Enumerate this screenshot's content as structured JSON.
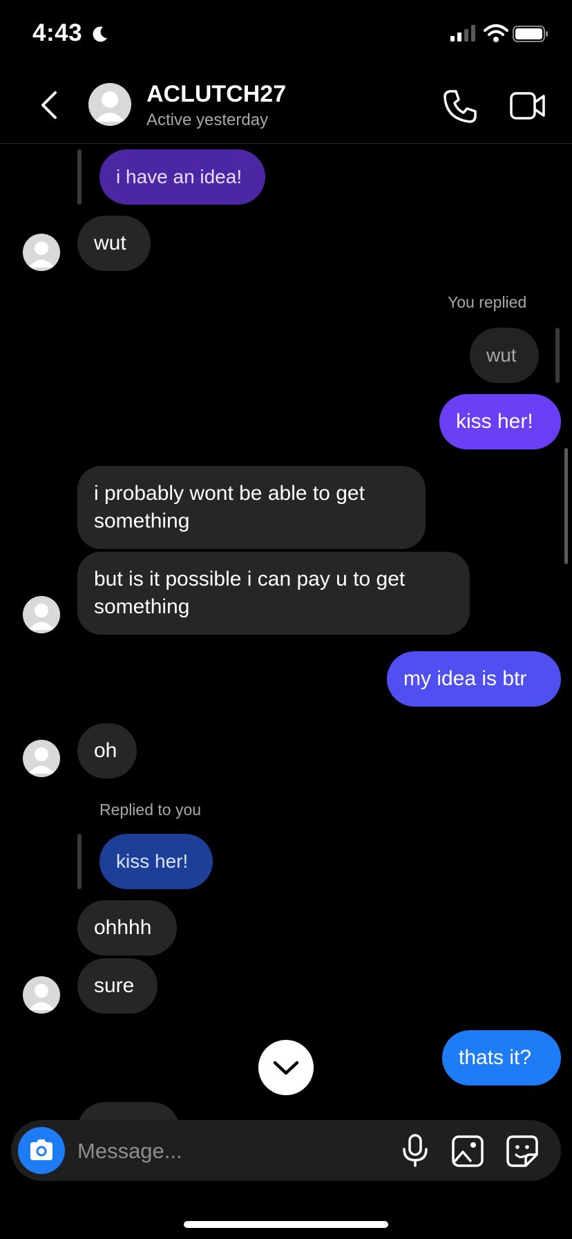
{
  "status_bar": {
    "time": "4:43"
  },
  "header": {
    "contact_name": "ACLUTCH27",
    "contact_status": "Active yesterday",
    "icons": [
      "back-icon",
      "phone-icon",
      "video-camera-icon"
    ]
  },
  "messages": {
    "m1_quoted": "i have an idea!",
    "m2": "wut",
    "m3_label": "You replied",
    "m3_quoted": "wut",
    "m4": "kiss her!",
    "m5": "i probably wont be able to get something",
    "m6": "but is it possible i can pay u to get something",
    "m7": "my idea is btr",
    "m8": "oh",
    "m9_label": "Replied to you",
    "m9_quoted": "kiss her!",
    "m10": "ohhhh",
    "m11": "sure",
    "m12": "thats it?"
  },
  "composer": {
    "placeholder": "Message...",
    "icons": [
      "camera-icon",
      "microphone-icon",
      "gallery-icon",
      "sticker-icon"
    ]
  },
  "colors": {
    "background": "#000000",
    "incoming_bubble": "#262626",
    "outgoing_purple": "#6a3ff5",
    "outgoing_indigo": "#4f4ff2",
    "outgoing_blue": "#1f7cf7",
    "secondary_text": "#a8a8a8"
  }
}
